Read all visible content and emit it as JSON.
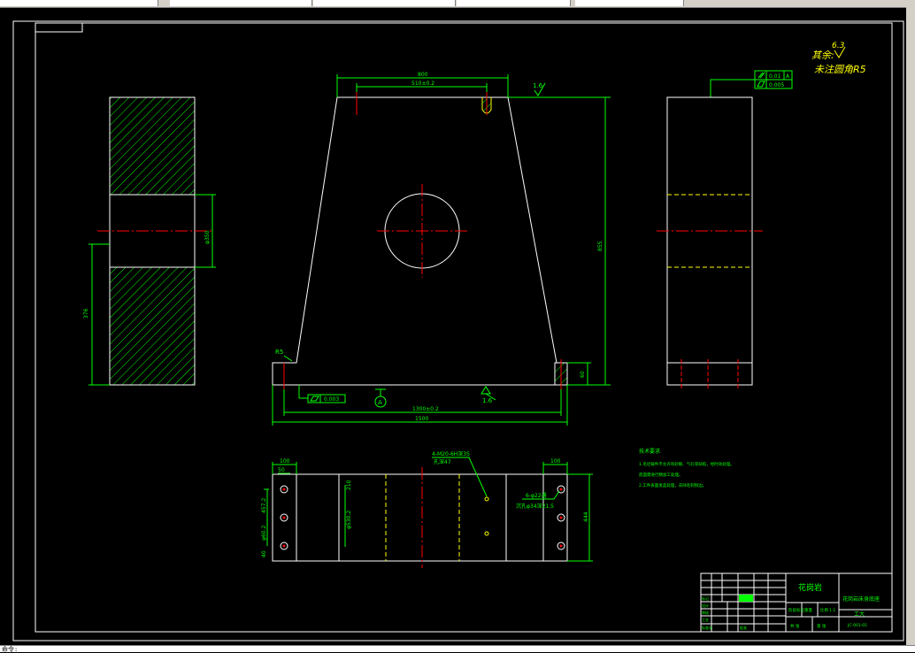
{
  "window": {
    "command_prompt": "命令:"
  },
  "colors": {
    "frame": "#ffffff",
    "dimension": "#00ff00",
    "centerline": "#ff0000",
    "hidden": "#ffff00",
    "hatch": "#00ff00",
    "background": "#000000"
  },
  "drawing": {
    "roughness_note": "其余:",
    "roughness_value": "6.3",
    "fillet_note": "未注圆角R5",
    "tolerance_frame": {
      "row1_value": "0.01",
      "row1_datum": "A",
      "row2_value": "0.005"
    },
    "front_view": {
      "top_width": "800",
      "hole_spacing": "510±0.2",
      "surface_finish": "1.6",
      "height": "855",
      "base_height": "60",
      "fillet": "R5",
      "flatness": "0.003",
      "datum": "A",
      "bottom_surface_finish": "1.6",
      "hole_pitch": "1300±0.2",
      "total_width": "1500"
    },
    "left_view": {
      "height": "376",
      "bore": "φ350"
    },
    "top_view": {
      "edge_left": "100",
      "edge_right": "100",
      "small_dim_left": "50",
      "dim_1": "457.2",
      "dim_2": "φ60.2",
      "dim_3": "40",
      "center_dim": "φ530.2",
      "center_small": "210",
      "thread_note_1": "4-M20-6H深35",
      "thread_note_2": "孔深47",
      "bolt_note_1": "6-φ22通",
      "bolt_note_2": "沉孔φ34深21.5",
      "depth": "444"
    },
    "tech_req": {
      "title": "技术要求",
      "line1": "1.毛坯铸件不允许有砂眼、气孔等缺陷，经时效处理。",
      "line2": "   底面需进行精加工处理。",
      "line3": "2.工件表面发蓝处理，去除毛刺锐边。"
    },
    "title_block": {
      "material": "花岗岩",
      "part_name": "花岗岩床身底座",
      "label_stage": "阶段标记",
      "label_weight": "重量",
      "label_scale": "比例",
      "scale": "1:1",
      "sheet_left": "共 张",
      "sheet_right": "第 张",
      "company": "工大",
      "drawing_no": "JC-001-01",
      "r_design": "设计",
      "r_check": "审核",
      "r_process": "工艺",
      "r_approve": "批准",
      "r_std": "标准化",
      "r_mark": "标记"
    }
  }
}
